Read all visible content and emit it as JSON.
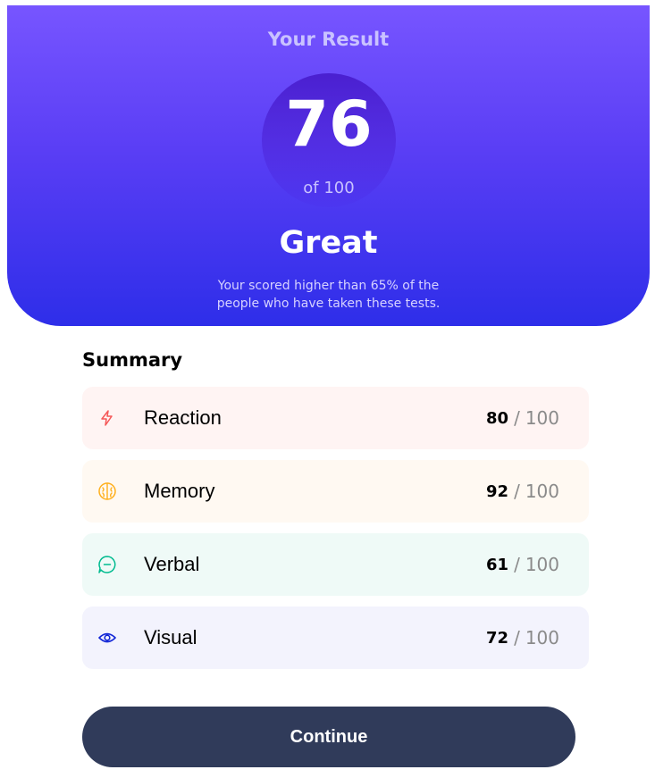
{
  "result": {
    "heading": "Your Result",
    "score": "76",
    "score_max": "of 100",
    "rating": "Great",
    "description": "Your scored higher than 65% of the people who have taken these tests."
  },
  "summary": {
    "title": "Summary",
    "items": [
      {
        "label": "Reaction",
        "score": "80",
        "max": "100",
        "icon": "lightning-icon",
        "color": "#f55757",
        "bg": "#fff4f3"
      },
      {
        "label": "Memory",
        "score": "92",
        "max": "100",
        "icon": "brain-icon",
        "color": "#ffb01f",
        "bg": "#fff9f2"
      },
      {
        "label": "Verbal",
        "score": "61",
        "max": "100",
        "icon": "chat-bubble-icon",
        "color": "#00bb8f",
        "bg": "#effaf7"
      },
      {
        "label": "Visual",
        "score": "72",
        "max": "100",
        "icon": "eye-icon",
        "color": "#1125d6",
        "bg": "#f3f3fd"
      }
    ],
    "separator": "/"
  },
  "continue_label": "Continue"
}
